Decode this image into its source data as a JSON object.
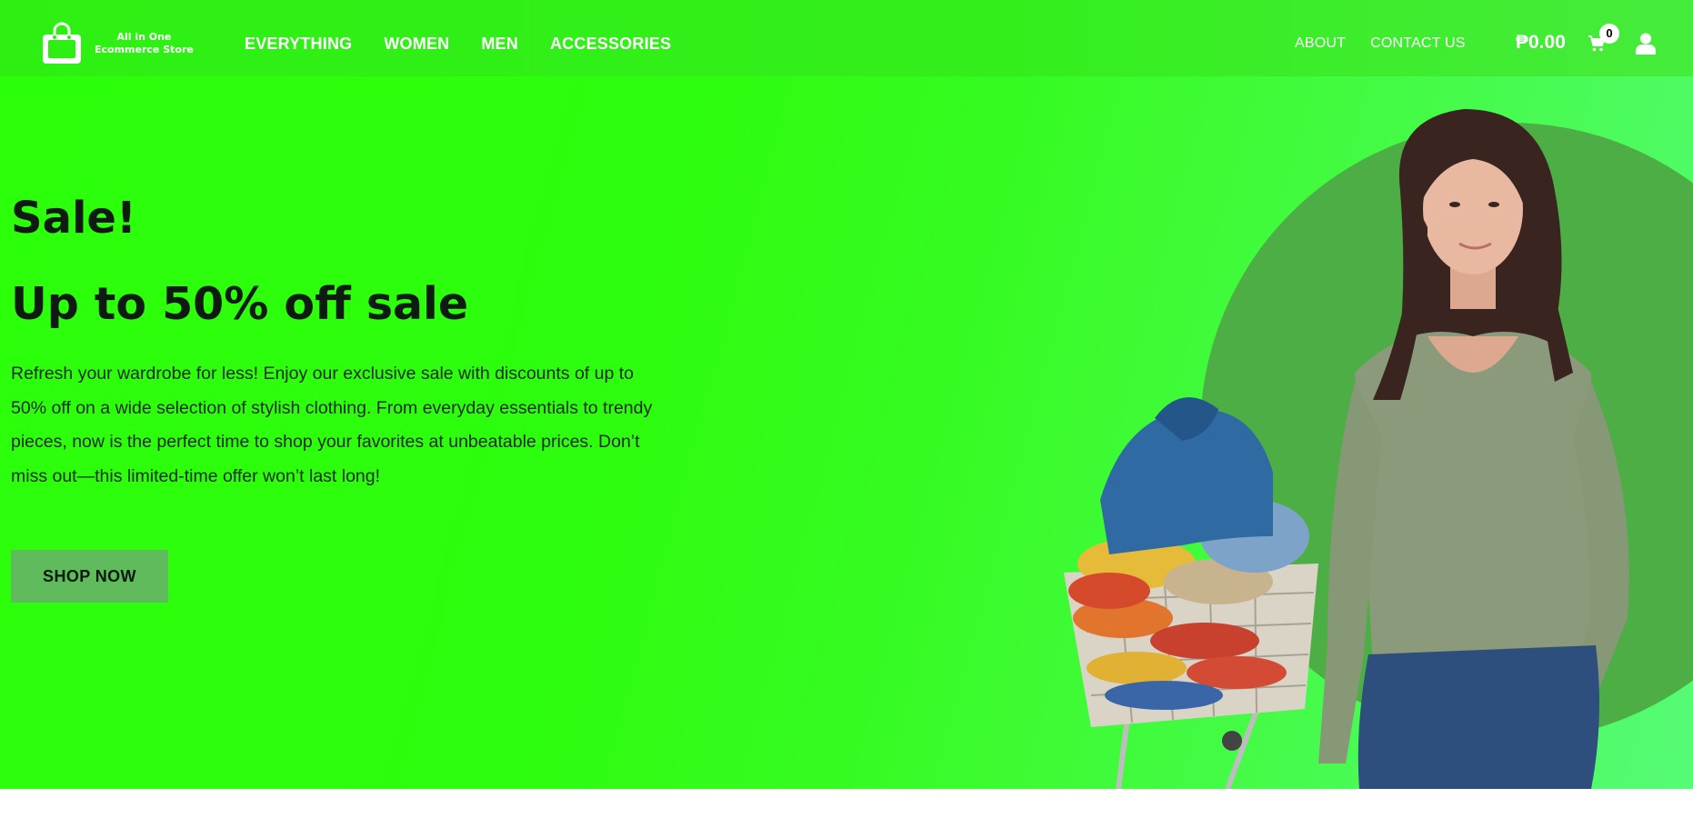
{
  "header": {
    "logo": {
      "line1": "All in One",
      "line2": "Ecommerce Store"
    },
    "nav_main": [
      "EVERYTHING",
      "WOMEN",
      "MEN",
      "ACCESSORIES"
    ],
    "nav_right": [
      "ABOUT",
      "CONTACT US"
    ],
    "cart_total": "₱0.00",
    "cart_count": "0"
  },
  "hero": {
    "kicker": "Sale!",
    "title": "Up to 50% off sale",
    "description": "Refresh your wardrobe for less! Enjoy our exclusive sale with discounts of up to 50% off on a wide selection of stylish clothing. From everyday essentials to trendy pieces, now is the perfect time to shop your favorites at unbeatable prices. Don’t miss out—this limited-time offer won’t last long!",
    "button_label": "SHOP NOW"
  },
  "icons": {
    "logo": "shopping-bag-icon",
    "cart": "cart-icon",
    "account": "user-icon"
  },
  "colors": {
    "hero_green": "#2bff0a",
    "button_green": "#5fbb5b",
    "circle_green": "#4cae45"
  }
}
